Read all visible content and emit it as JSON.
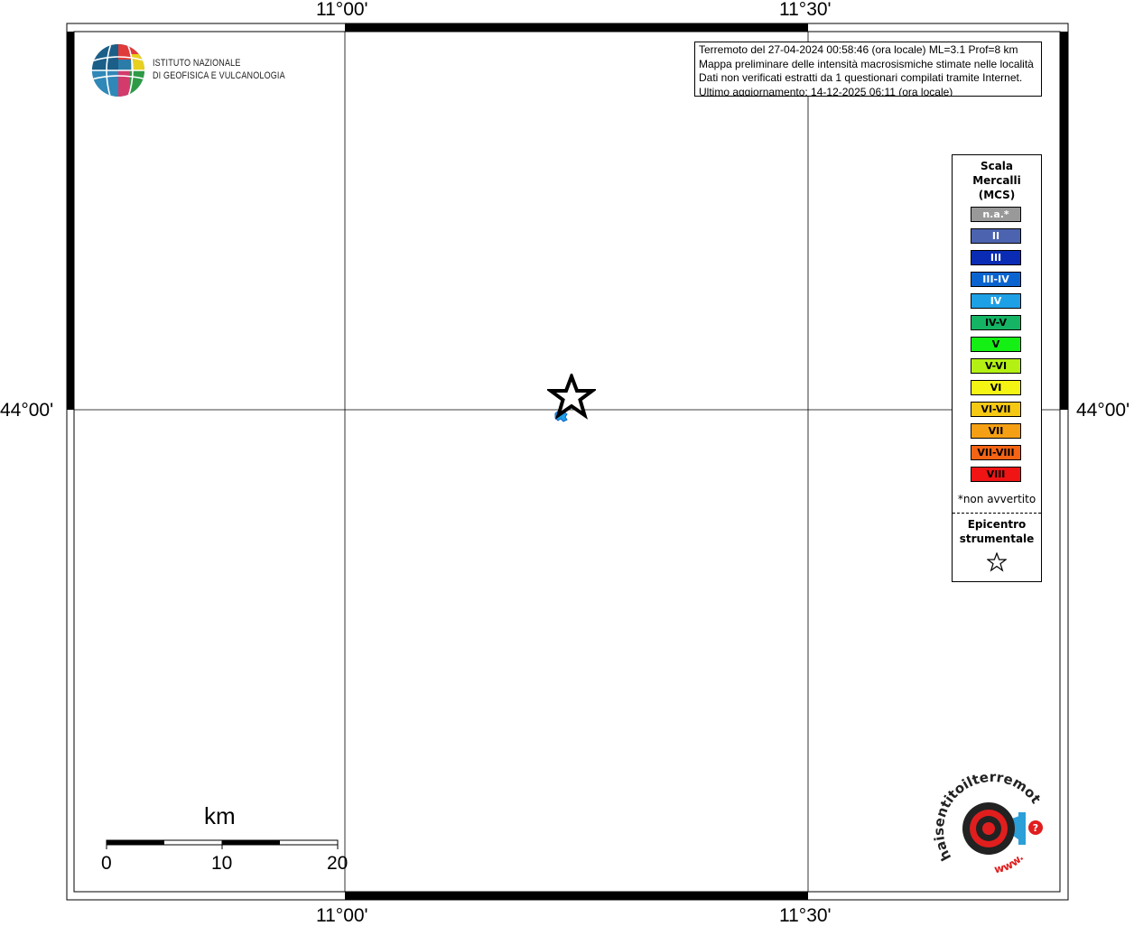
{
  "map": {
    "frame_labels": {
      "lon_left": "11°00'",
      "lon_right": "11°30'",
      "lat": "44°00'"
    }
  },
  "info_box": {
    "lines": [
      "Terremoto del 27-04-2024 00:58:46 (ora locale) ML=3.1 Prof=8 km",
      "Mappa preliminare delle intensità macrosismiche stimate nelle località",
      "Dati non verificati estratti da 1 questionari compilati tramite Internet.",
      "Ultimo aggiornamento: 14-12-2025 06:11 (ora locale)"
    ]
  },
  "logo": {
    "line1": "ISTITUTO NAZIONALE",
    "line2": "DI GEOFISICA E VULCANOLOGIA",
    "icon": "ingv-globe-logo"
  },
  "legend": {
    "title_lines": [
      "Scala",
      "Mercalli",
      "(MCS)"
    ],
    "items": [
      {
        "label": "n.a.*",
        "color": "#999999",
        "text_color": "#ffffff"
      },
      {
        "label": "II",
        "color": "#4c63b0",
        "text_color": "#ffffff"
      },
      {
        "label": "III",
        "color": "#0a2cb4",
        "text_color": "#ffffff"
      },
      {
        "label": "III-IV",
        "color": "#0a64d0",
        "text_color": "#ffffff"
      },
      {
        "label": "IV",
        "color": "#1ea0e6",
        "text_color": "#ffffff"
      },
      {
        "label": "IV-V",
        "color": "#14b464",
        "text_color": "#000000"
      },
      {
        "label": "V",
        "color": "#14f014",
        "text_color": "#000000"
      },
      {
        "label": "V-VI",
        "color": "#b4f014",
        "text_color": "#000000"
      },
      {
        "label": "VI",
        "color": "#f5f514",
        "text_color": "#000000"
      },
      {
        "label": "VI-VII",
        "color": "#f5c814",
        "text_color": "#000000"
      },
      {
        "label": "VII",
        "color": "#f5a014",
        "text_color": "#000000"
      },
      {
        "label": "VII-VIII",
        "color": "#f56414",
        "text_color": "#000000"
      },
      {
        "label": "VIII",
        "color": "#f01414",
        "text_color": "#000000"
      }
    ],
    "footnote": "*non avvertito",
    "epicenter_lines": [
      "Epicentro",
      "strumentale"
    ],
    "epicenter_icon": "star-outline-icon"
  },
  "scalebar": {
    "unit": "km",
    "ticks": [
      "0",
      "10",
      "20"
    ]
  },
  "badge": {
    "icon": "haisentito-logo",
    "text_top": "haisentitoilterremoto.it",
    "text_bottom": "www."
  },
  "event": {
    "marker_icon": "epicenter-star-icon",
    "intensity_marker_color": "#1ea0e6"
  }
}
